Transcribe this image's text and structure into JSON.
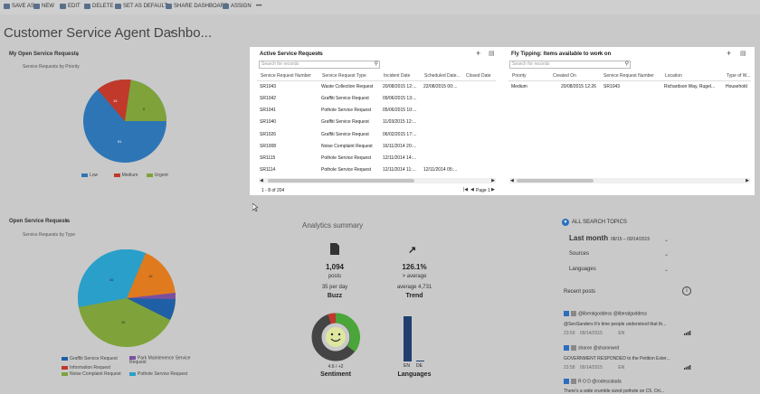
{
  "toolbar": {
    "save_as": "SAVE AS",
    "new": "NEW",
    "edit": "EDIT",
    "delete": "DELETE",
    "set_default": "SET AS DEFAULT",
    "share": "SHARE DASHBOARD",
    "assign": "ASSIGN",
    "more": "•••"
  },
  "page": {
    "title": "Customer Service Agent Dashbo..."
  },
  "panel1": {
    "title": "My Open Service Requests",
    "subtitle": "Service Requests by Priority",
    "legend": [
      {
        "label": "Low",
        "color": "#2e75b6"
      },
      {
        "label": "Medium",
        "color": "#c0392b"
      },
      {
        "label": "Urgent",
        "color": "#7fa33a"
      }
    ],
    "slice_labels": [
      "51",
      "15",
      "8"
    ]
  },
  "panel2": {
    "title": "Open Service Requests",
    "subtitle": "Service Requests by Type",
    "legend": [
      {
        "label": "Graffiti Service Request",
        "color": "#1f5fa6"
      },
      {
        "label": "Park Maintenence Service Request",
        "color": "#7b4fa0"
      },
      {
        "label": "Information Request",
        "color": "#c0392b"
      },
      {
        "label": "Noise Complaint Request",
        "color": "#7fa33a"
      },
      {
        "label": "Pothole Service Request",
        "color": "#2a9fc9"
      }
    ],
    "slice_labels": [
      "36",
      "36",
      "18"
    ]
  },
  "grid1": {
    "title": "Active Service Requests",
    "search_placeholder": "Search for records",
    "columns": [
      "Service Request Number",
      "Service Request Type",
      "Incident Date",
      "Scheduled Date...",
      "Closed Date"
    ],
    "rows": [
      [
        "SR1043",
        "Waste Collection Request",
        "20/08/2015 12:...",
        "22/08/2015 00:...",
        ""
      ],
      [
        "SR1042",
        "Graffiti Service Request",
        "09/06/2015 13:...",
        "",
        ""
      ],
      [
        "SR1041",
        "Pothole Service Request",
        "05/06/2015 10:...",
        "",
        ""
      ],
      [
        "SR1040",
        "Graffiti Service Request",
        "11/03/2015 12:...",
        "",
        ""
      ],
      [
        "SR1026",
        "Graffiti Service Request",
        "06/02/2015 17:...",
        "",
        ""
      ],
      [
        "SR1008",
        "Noise Complaint Request",
        "16/11/2014 20:...",
        "",
        ""
      ],
      [
        "SR1115",
        "Pothole Service Request",
        "12/11/2014 14:...",
        "",
        ""
      ],
      [
        "SR1114",
        "Pothole Service Request",
        "12/11/2014 11:...",
        "12/11/2014 05:...",
        ""
      ]
    ],
    "footer": "1 - 8 of 204",
    "page_label": "Page 1"
  },
  "grid2": {
    "title": "Fly Tipping: Items available to work on",
    "search_placeholder": "Search for records",
    "columns": [
      "Priority",
      "Created On",
      "Service Request Number",
      "Location",
      "Type of W..."
    ],
    "rows": [
      [
        "Medium",
        "20/08/2015 12:26",
        "SR1043",
        "Richardson Way, Rugel...",
        "Household"
      ]
    ]
  },
  "analytics": {
    "title": "Analytics summary",
    "buzz": {
      "value": "1,094",
      "unit": "posts",
      "rate": "35 per day",
      "label": "Buzz"
    },
    "trend": {
      "value": "126.1%",
      "cmp": "> average",
      "avg": "average 4,731",
      "label": "Trend"
    },
    "sentiment": {
      "value": "4.6 / +2",
      "label": "Sentiment"
    },
    "languages": {
      "label": "Languages",
      "bars": [
        {
          "code": "EN",
          "share": 1.0
        },
        {
          "code": "DE",
          "share": 0.02
        }
      ]
    }
  },
  "social": {
    "header": "ALL SEARCH TOPICS",
    "period": "Last month",
    "period_range": "08/15 – 09/14/2015",
    "sources": "Sources",
    "languages": "Languages",
    "recent": "Recent posts",
    "posts": [
      {
        "handle": "@liberalgoddess @liberalgoddess",
        "text": "@SenSanders It's time people understood that th...",
        "time": "23:59",
        "date": "09/14/2015",
        "lang": "EN"
      },
      {
        "handle": "sharon @sharonwrd",
        "text": "GOVERNMENT RESPONDED to the Petition Exter...",
        "time": "23:58",
        "date": "09/14/2015",
        "lang": "EN"
      },
      {
        "handle": "R O D @rodescalada",
        "text": "There's a wide crumble sized pothole on C5. Ort...",
        "time": "",
        "date": "",
        "lang": ""
      }
    ]
  }
}
